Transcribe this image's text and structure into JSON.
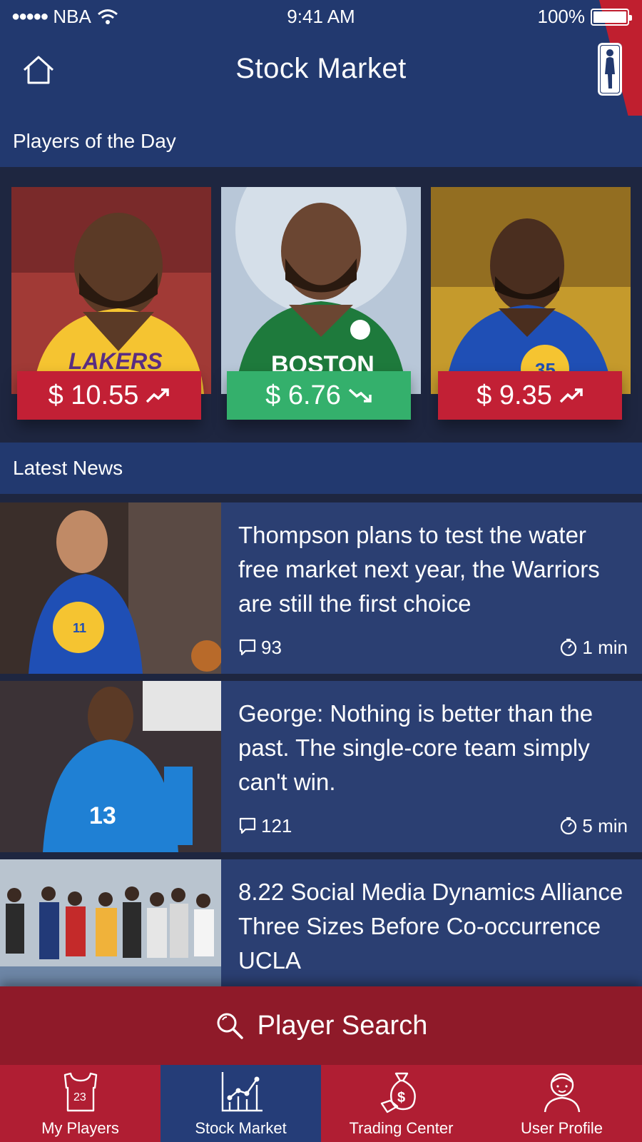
{
  "status_bar": {
    "carrier": "NBA",
    "signal_dots": "●●●●●",
    "time": "9:41 AM",
    "battery": "100%"
  },
  "header": {
    "title": "Stock Market",
    "home_icon": "home-icon",
    "logo_icon": "nba-logo-icon"
  },
  "players_section": {
    "title": "Players of the Day",
    "players": [
      {
        "price": "$ 10.55",
        "trend": "up",
        "team_color": "#f5c431",
        "bg": "#a13a36"
      },
      {
        "price": "$ 6.76",
        "trend": "down",
        "team_color": "#1e7a3c",
        "bg": "#9fb2c8"
      },
      {
        "price": "$ 9.35",
        "trend": "up",
        "team_color": "#1f4fb5",
        "bg": "#c59a2c"
      }
    ]
  },
  "news_section": {
    "title": "Latest News",
    "items": [
      {
        "headline": "Thompson plans to test the water free market next year, the Warriors are still the first choice",
        "comments": "93",
        "time": "1 min"
      },
      {
        "headline": "George: Nothing is better than the past. The single-core team simply can't win.",
        "comments": "121",
        "time": "5 min"
      },
      {
        "headline": "8.22 Social Media Dynamics Alliance Three Sizes Before Co-occurrence UCLA",
        "comments": "",
        "time": ""
      }
    ]
  },
  "search": {
    "label": "Player Search",
    "icon": "search-icon"
  },
  "tabbar": {
    "items": [
      {
        "label": "My Players",
        "icon": "jersey-icon",
        "badge": "23",
        "active": false
      },
      {
        "label": "Stock Market",
        "icon": "chart-icon",
        "active": true
      },
      {
        "label": "Trading Center",
        "icon": "money-bag-icon",
        "active": false
      },
      {
        "label": "User Profile",
        "icon": "user-icon",
        "active": false
      }
    ]
  },
  "colors": {
    "navy": "#22396f",
    "red": "#b01e33",
    "green": "#34b06c"
  }
}
